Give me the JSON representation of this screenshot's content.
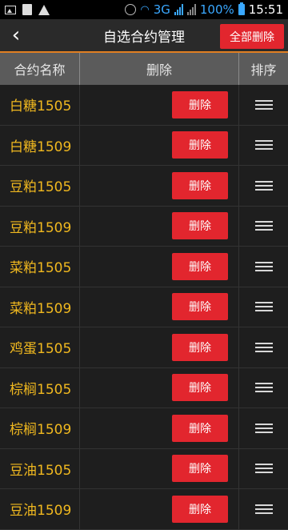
{
  "status_bar": {
    "network": "3G",
    "battery": "100%",
    "time": "15:51",
    "icons": [
      "image-icon",
      "sim-card-icon",
      "warning-icon",
      "alarm-icon",
      "wifi-icon",
      "signal-icon",
      "signal-icon",
      "battery-icon"
    ]
  },
  "header": {
    "title": "自选合约管理",
    "delete_all_label": "全部删除",
    "back_icon": "‹"
  },
  "table": {
    "columns": [
      "合约名称",
      "删除",
      "排序"
    ],
    "delete_label": "删除",
    "rows": [
      {
        "name": "白糖1505"
      },
      {
        "name": "白糖1509"
      },
      {
        "name": "豆粕1505"
      },
      {
        "name": "豆粕1509"
      },
      {
        "name": "菜粕1505"
      },
      {
        "name": "菜粕1509"
      },
      {
        "name": "鸡蛋1505"
      },
      {
        "name": "棕榈1505"
      },
      {
        "name": "棕榈1509"
      },
      {
        "name": "豆油1505"
      },
      {
        "name": "豆油1509"
      }
    ]
  },
  "colors": {
    "accent": "#e07f22",
    "delete_red": "#e2262e",
    "name_yellow": "#f0b81f",
    "status_blue": "#3aa8ff"
  }
}
